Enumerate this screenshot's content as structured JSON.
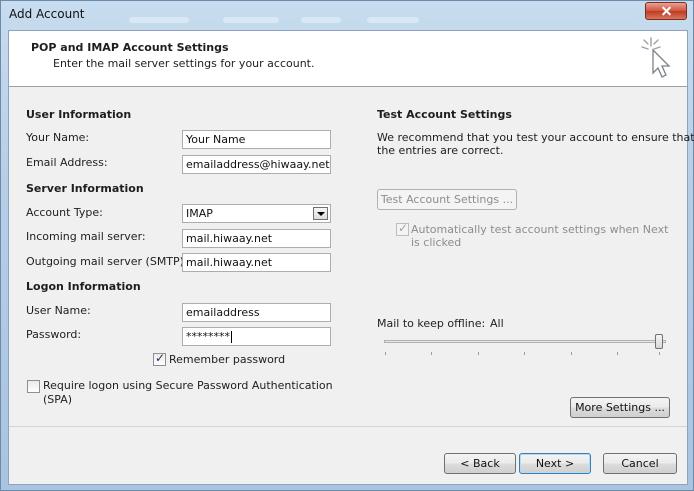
{
  "window": {
    "title": "Add Account"
  },
  "header": {
    "title": "POP and IMAP Account Settings",
    "subtitle": "Enter the mail server settings for your account.",
    "icon": "cursor-sparkle-icon"
  },
  "user_info": {
    "section": "User Information",
    "name_label": "Your Name:",
    "name_value": "Your Name",
    "email_label": "Email Address:",
    "email_value": "emailaddress@hiwaay.net"
  },
  "server_info": {
    "section": "Server Information",
    "account_type_label": "Account Type:",
    "account_type_value": "IMAP",
    "incoming_label": "Incoming mail server:",
    "incoming_value": "mail.hiwaay.net",
    "outgoing_label": "Outgoing mail server (SMTP):",
    "outgoing_value": "mail.hiwaay.net"
  },
  "logon_info": {
    "section": "Logon Information",
    "username_label": "User Name:",
    "username_value": "emailaddress",
    "password_label": "Password:",
    "password_value": "********",
    "remember_label": "Remember password",
    "remember_checked": true,
    "spa_label_line1": "Require logon using Secure Password Authentication",
    "spa_label_line2": "(SPA)",
    "spa_checked": false
  },
  "test_settings": {
    "section": "Test Account Settings",
    "desc_line1": "We recommend that you test your account to ensure that",
    "desc_line2": "the entries are correct.",
    "test_button": "Test Account Settings ...",
    "auto_test_line1": "Automatically test account settings when Next",
    "auto_test_line2": "is clicked",
    "auto_test_checked": true
  },
  "offline": {
    "label": "Mail to keep offline:",
    "value": "All",
    "level_fraction": 1.0
  },
  "buttons": {
    "more_settings": "More Settings ...",
    "back": "< Back",
    "next": "Next >",
    "cancel": "Cancel"
  }
}
